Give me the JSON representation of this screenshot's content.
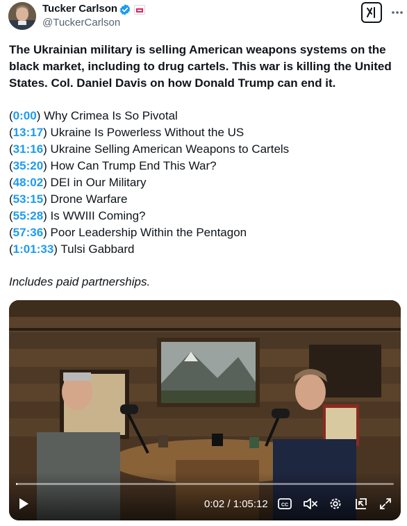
{
  "author": {
    "name": "Tucker Carlson",
    "handle": "@TuckerCarlson",
    "avatar_icon": "profile-photo",
    "verified_icon": "verified-badge-icon",
    "verified_color": "#1d9bf0"
  },
  "toolbar": {
    "grok_icon": "grok-icon",
    "more_icon": "more-options-icon"
  },
  "post": {
    "headline": "The Ukrainian military is selling American weapons systems on the black market, including to drug cartels. This war is killing the United States. Col. Daniel Davis on how Donald Trump can end it.",
    "chapters": [
      {
        "time": "0:00",
        "title": "Why Crimea Is So Pivotal"
      },
      {
        "time": "13:17",
        "title": "Ukraine Is Powerless Without the US"
      },
      {
        "time": "31:16",
        "title": "Ukraine Selling American Weapons to Cartels"
      },
      {
        "time": "35:20",
        "title": "How Can Trump End This War?"
      },
      {
        "time": "48:02",
        "title": "DEI in Our Military"
      },
      {
        "time": "53:15",
        "title": "Drone Warfare"
      },
      {
        "time": "55:28",
        "title": "Is WWIII Coming?"
      },
      {
        "time": "57:36",
        "title": "Poor Leadership Within the Pentagon"
      },
      {
        "time": "1:01:33",
        "title": "Tulsi Gabbard"
      }
    ],
    "disclosure": "Includes paid partnerships.",
    "link_color": "#1d9bf0"
  },
  "video": {
    "time_display": "0:02 / 1:05:12",
    "progress_fraction": 0.0005,
    "controls": [
      "play-icon",
      "captions-icon",
      "mute-icon",
      "settings-icon",
      "pip-icon",
      "fullscreen-icon"
    ]
  }
}
